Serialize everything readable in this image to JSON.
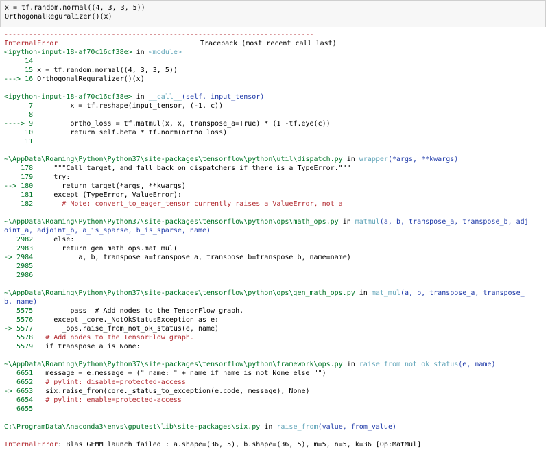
{
  "input_cell": {
    "line1": "x = tf.random.normal((4, 3, 3, 5))",
    "line2": "OrthogonalReguralizer()(x)"
  },
  "traceback": {
    "separator": "---------------------------------------------------------------------------",
    "error_type": "InternalError",
    "header_right": "Traceback (most recent call last)",
    "frame1": {
      "file": "<ipython-input-18-af70c16cf38e>",
      "in": " in ",
      "func": "<module>",
      "lines": [
        {
          "n": "     14",
          "code": ""
        },
        {
          "n": "     15",
          "code": " x = tf.random.normal((4, 3, 3, 5))"
        },
        {
          "n": "---> 16",
          "code": " OrthogonalReguralizer()(x)"
        }
      ]
    },
    "frame2": {
      "file": "<ipython-input-18-af70c16cf38e>",
      "in": " in ",
      "func": "__call__",
      "args": "(self, input_tensor)",
      "lines": [
        {
          "n": "      7",
          "code": "         x = tf.reshape(input_tensor, (-1, c))"
        },
        {
          "n": "      8",
          "code": ""
        },
        {
          "n": "----> 9",
          "code": "         ortho_loss = tf.matmul(x, x, transpose_a=True) * (1 -tf.eye(c))"
        },
        {
          "n": "     10",
          "code": "         return self.beta * tf.norm(ortho_loss)"
        },
        {
          "n": "     11",
          "code": ""
        }
      ]
    },
    "frame3": {
      "file": "~\\AppData\\Roaming\\Python\\Python37\\site-packages\\tensorflow\\python\\util\\dispatch.py",
      "in": " in ",
      "func": "wrapper",
      "args": "(*args, **kwargs)",
      "lines": [
        {
          "n": "    178",
          "code": "     \"\"\"Call target, and fall back on dispatchers if there is a TypeError.\"\"\""
        },
        {
          "n": "    179",
          "code": "     try:"
        },
        {
          "n": "--> 180",
          "code": "       return target(*args, **kwargs)"
        },
        {
          "n": "    181",
          "code": "     except (TypeError, ValueError):"
        },
        {
          "n": "    182",
          "code": "       # Note: convert_to_eager_tensor currently raises a ValueError, not a"
        }
      ]
    },
    "frame4": {
      "file": "~\\AppData\\Roaming\\Python\\Python37\\site-packages\\tensorflow\\python\\ops\\math_ops.py",
      "in": " in ",
      "func": "matmul",
      "args": "(a, b, transpose_a, transpose_b, adj",
      "args2": "oint_a, adjoint_b, a_is_sparse, b_is_sparse, name)",
      "lines": [
        {
          "n": "   2982",
          "code": "     else:"
        },
        {
          "n": "   2983",
          "code": "       return gen_math_ops.mat_mul("
        },
        {
          "n": "-> 2984",
          "code": "           a, b, transpose_a=transpose_a, transpose_b=transpose_b, name=name)"
        },
        {
          "n": "   2985",
          "code": ""
        },
        {
          "n": "   2986",
          "code": ""
        }
      ]
    },
    "frame5": {
      "file": "~\\AppData\\Roaming\\Python\\Python37\\site-packages\\tensorflow\\python\\ops\\gen_math_ops.py",
      "in": " in ",
      "func": "mat_mul",
      "args": "(a, b, transpose_a, transpose_",
      "args2": "b, name)",
      "lines": [
        {
          "n": "   5575",
          "code": "         pass  # Add nodes to the TensorFlow graph."
        },
        {
          "n": "   5576",
          "code": "     except _core._NotOkStatusException as e:"
        },
        {
          "n": "-> 5577",
          "code": "       _ops.raise_from_not_ok_status(e, name)"
        },
        {
          "n": "   5578",
          "code": "   # Add nodes to the TensorFlow graph."
        },
        {
          "n": "   5579",
          "code": "   if transpose_a is None:"
        }
      ]
    },
    "frame6": {
      "file": "~\\AppData\\Roaming\\Python\\Python37\\site-packages\\tensorflow\\python\\framework\\ops.py",
      "in": " in ",
      "func": "raise_from_not_ok_status",
      "args": "(e, name)",
      "lines": [
        {
          "n": "   6651",
          "code": "   message = e.message + (\" name: \" + name if name is not None else \"\")"
        },
        {
          "n": "   6652",
          "code": "   # pylint: disable=protected-access"
        },
        {
          "n": "-> 6653",
          "code": "   six.raise_from(core._status_to_exception(e.code, message), None)"
        },
        {
          "n": "   6654",
          "code": "   # pylint: enable=protected-access"
        },
        {
          "n": "   6655",
          "code": ""
        }
      ]
    },
    "frame7": {
      "file": "C:\\ProgramData\\Anaconda3\\envs\\gputest\\lib\\site-packages\\six.py",
      "in": " in ",
      "func": "raise_from",
      "args": "(value, from_value)"
    },
    "final_error": {
      "type": "InternalError",
      "message": ": Blas GEMM launch failed : a.shape=(36, 5), b.shape=(36, 5), m=5, n=5, k=36 [Op:MatMul]"
    }
  },
  "colors": {
    "error_red": "#b22b31",
    "lineno_green": "#007427",
    "func_cyan": "#60a4b8",
    "args_blue": "#1f3aa8"
  }
}
